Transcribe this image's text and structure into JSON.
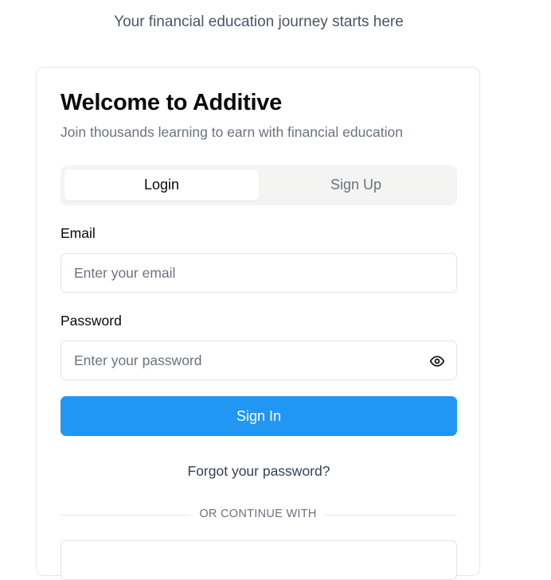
{
  "header": {
    "tagline": "Your financial education journey starts here"
  },
  "card": {
    "title": "Welcome to Additive",
    "subtitle": "Join thousands learning to earn with financial education"
  },
  "tabs": {
    "login_label": "Login",
    "signup_label": "Sign Up",
    "active": "Login"
  },
  "form": {
    "email_label": "Email",
    "email_placeholder": "Enter your email",
    "email_value": "",
    "password_label": "Password",
    "password_placeholder": "Enter your password",
    "password_value": "",
    "password_toggle_icon": "eye-icon",
    "submit_label": "Sign In"
  },
  "links": {
    "forgot_password": "Forgot your password?"
  },
  "divider": {
    "text": "OR CONTINUE WITH"
  },
  "colors": {
    "primary": "#2196f3",
    "tab_background": "#f4f4f3",
    "muted_text": "#6b7280"
  }
}
